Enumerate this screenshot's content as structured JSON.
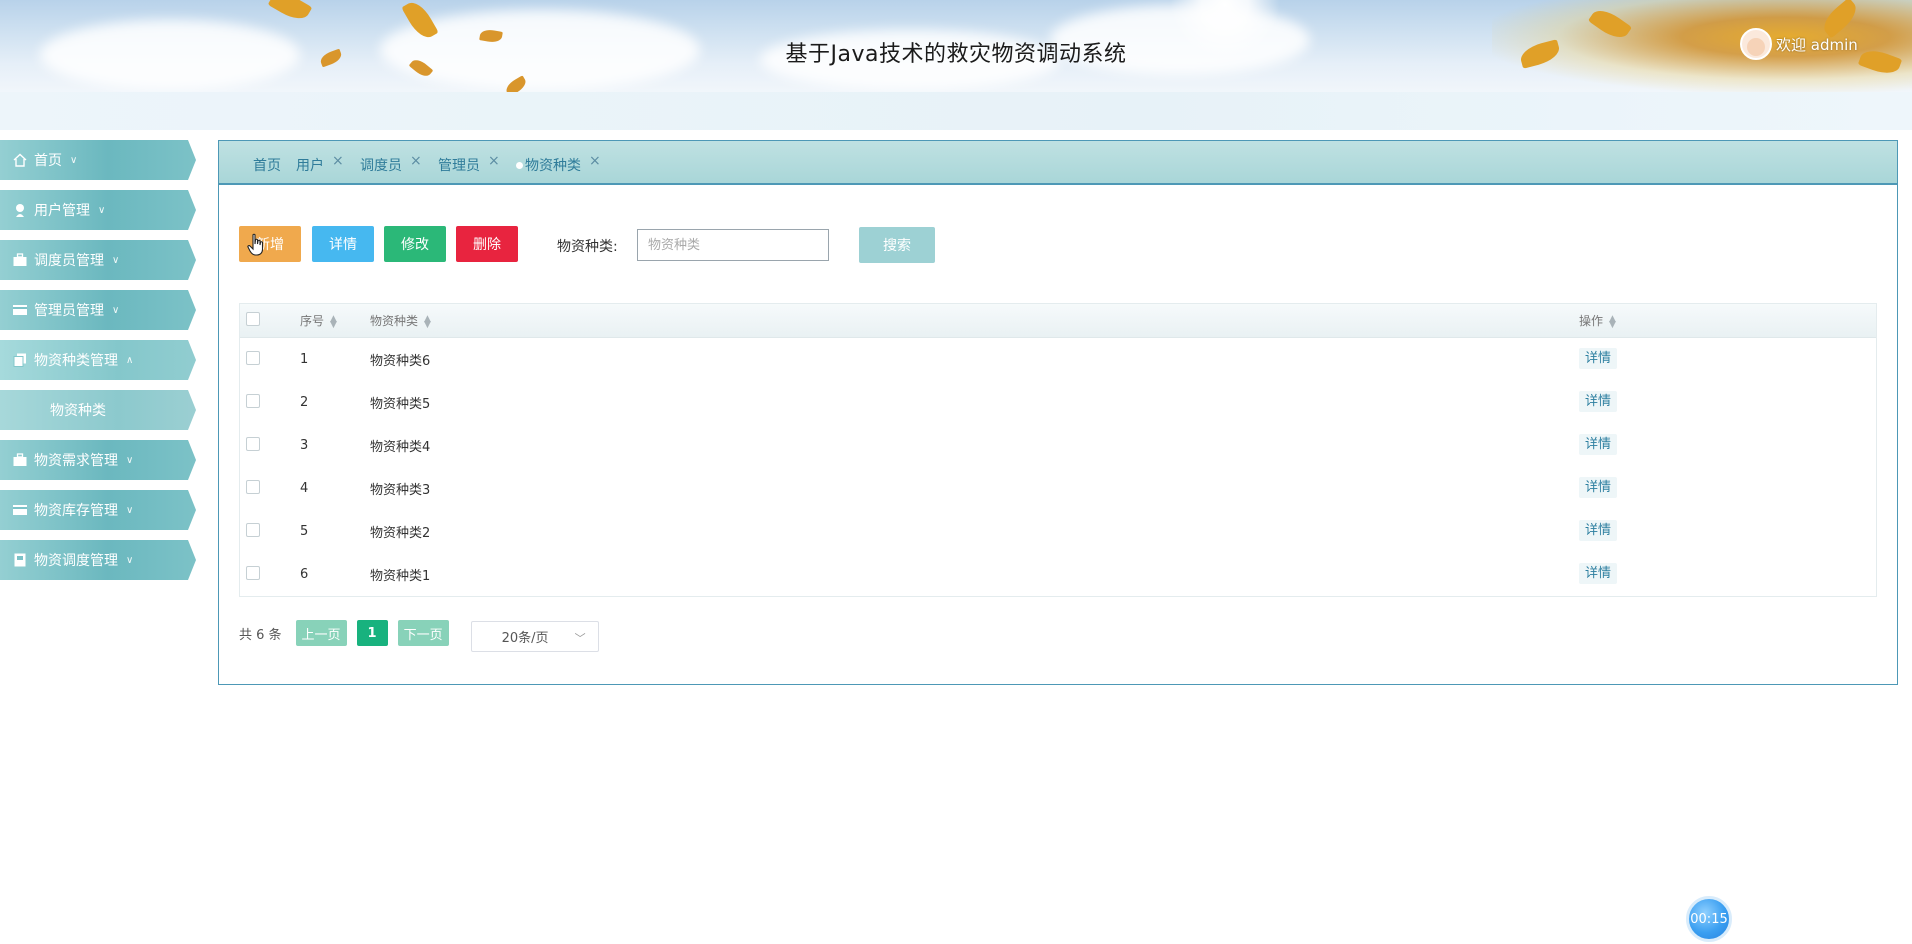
{
  "header": {
    "title": "基于Java技术的救灾物资调动系统",
    "welcome": "欢迎 admin"
  },
  "sidebar": {
    "items": [
      {
        "label": "首页",
        "icon": "home-icon",
        "chevron": "∨"
      },
      {
        "label": "用户管理",
        "icon": "user-icon",
        "chevron": "∨"
      },
      {
        "label": "调度员管理",
        "icon": "briefcase-icon",
        "chevron": "∨"
      },
      {
        "label": "管理员管理",
        "icon": "card-icon",
        "chevron": "∨"
      },
      {
        "label": "物资种类管理",
        "icon": "copy-icon",
        "chevron": "∧"
      },
      {
        "label": "物资种类",
        "sub": true
      },
      {
        "label": "物资需求管理",
        "icon": "briefcase-icon",
        "chevron": "∨"
      },
      {
        "label": "物资库存管理",
        "icon": "card-icon",
        "chevron": "∨"
      },
      {
        "label": "物资调度管理",
        "icon": "doc-icon",
        "chevron": "∨"
      }
    ]
  },
  "tabs": [
    {
      "label": "首页",
      "closable": false
    },
    {
      "label": "用户",
      "closable": true
    },
    {
      "label": "调度员",
      "closable": true
    },
    {
      "label": "管理员",
      "closable": true
    },
    {
      "label": "物资种类",
      "closable": true,
      "active": true
    }
  ],
  "tab_close": "×",
  "toolbar": {
    "add": "新增",
    "detail": "详情",
    "edit": "修改",
    "delete": "删除",
    "search_label": "物资种类:",
    "search_placeholder": "物资种类",
    "search_button": "搜索"
  },
  "table": {
    "columns": [
      "序号",
      "物资种类",
      "操作"
    ],
    "rows": [
      {
        "index": "1",
        "name": "物资种类6",
        "op": "详情"
      },
      {
        "index": "2",
        "name": "物资种类5",
        "op": "详情"
      },
      {
        "index": "3",
        "name": "物资种类4",
        "op": "详情"
      },
      {
        "index": "4",
        "name": "物资种类3",
        "op": "详情"
      },
      {
        "index": "5",
        "name": "物资种类2",
        "op": "详情"
      },
      {
        "index": "6",
        "name": "物资种类1",
        "op": "详情"
      }
    ]
  },
  "pagination": {
    "total": "共 6 条",
    "prev": "上一页",
    "current": "1",
    "next": "下一页",
    "page_size": "20条/页"
  },
  "timer": "00:15",
  "colors": {
    "add": "#f0a94d",
    "detail": "#46b8f0",
    "edit": "#2bb878",
    "delete": "#e8243f",
    "accent": "#4d98b6"
  }
}
